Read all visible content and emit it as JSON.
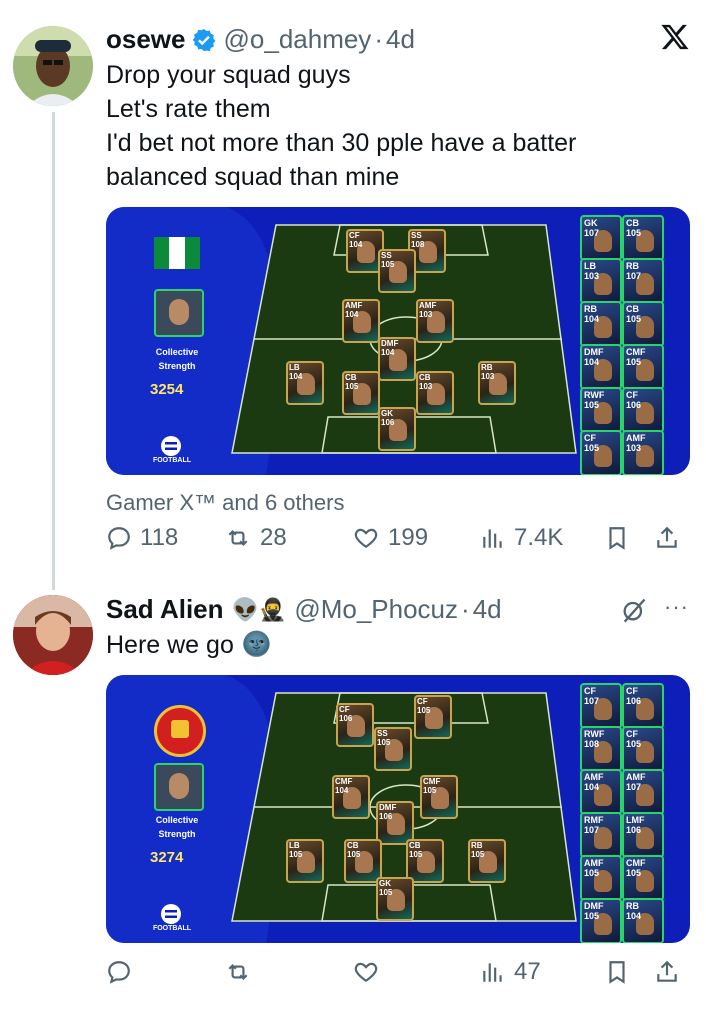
{
  "tweet1": {
    "name": "osewe",
    "handle": "@o_dahmey",
    "dot": "·",
    "time": "4d",
    "text_lines": [
      "Drop your squad guys",
      "Let's rate them",
      "I'd bet not more than 30 pple have a batter",
      "balanced squad than mine"
    ],
    "media": {
      "strength_label_1": "Collective",
      "strength_label_2": "Strength",
      "strength_value": "3254",
      "brand": "FOOTBALL",
      "cards": [
        {
          "pos": "CF",
          "rating": "104"
        },
        {
          "pos": "SS",
          "rating": "108"
        },
        {
          "pos": "SS",
          "rating": "105"
        },
        {
          "pos": "AMF",
          "rating": "104"
        },
        {
          "pos": "AMF",
          "rating": "103"
        },
        {
          "pos": "DMF",
          "rating": "104"
        },
        {
          "pos": "LB",
          "rating": "104"
        },
        {
          "pos": "CB",
          "rating": "105"
        },
        {
          "pos": "CB",
          "rating": "103"
        },
        {
          "pos": "RB",
          "rating": "103"
        },
        {
          "pos": "GK",
          "rating": "106"
        }
      ],
      "subs": [
        {
          "pos": "GK",
          "rating": "107"
        },
        {
          "pos": "CB",
          "rating": "105"
        },
        {
          "pos": "LB",
          "rating": "103"
        },
        {
          "pos": "RB",
          "rating": "107"
        },
        {
          "pos": "RB",
          "rating": "104"
        },
        {
          "pos": "CB",
          "rating": "105"
        },
        {
          "pos": "DMF",
          "rating": "104"
        },
        {
          "pos": "CMF",
          "rating": "105"
        },
        {
          "pos": "RWF",
          "rating": "105"
        },
        {
          "pos": "CF",
          "rating": "106"
        },
        {
          "pos": "CF",
          "rating": "105"
        },
        {
          "pos": "AMF",
          "rating": "103"
        }
      ]
    },
    "liked_by": "Gamer X™ and 6 others",
    "replies": "118",
    "reposts": "28",
    "likes": "199",
    "views": "7.4K"
  },
  "tweet2": {
    "name": "Sad Alien",
    "name_emoji": "👽🥷",
    "handle": "@Mo_Phocuz",
    "dot": "·",
    "time": "4d",
    "text": "Here we go",
    "text_emoji": "🌚",
    "media": {
      "strength_label_1": "Collective",
      "strength_label_2": "Strength",
      "strength_value": "3274",
      "brand": "FOOTBALL",
      "cards": [
        {
          "pos": "CF",
          "rating": "106"
        },
        {
          "pos": "CF",
          "rating": "105"
        },
        {
          "pos": "SS",
          "rating": "105"
        },
        {
          "pos": "CMF",
          "rating": "104"
        },
        {
          "pos": "CMF",
          "rating": "105"
        },
        {
          "pos": "DMF",
          "rating": "106"
        },
        {
          "pos": "LB",
          "rating": "105"
        },
        {
          "pos": "CB",
          "rating": "105"
        },
        {
          "pos": "CB",
          "rating": "105"
        },
        {
          "pos": "RB",
          "rating": "105"
        },
        {
          "pos": "GK",
          "rating": "105"
        }
      ],
      "subs": [
        {
          "pos": "CF",
          "rating": "107"
        },
        {
          "pos": "CF",
          "rating": "106"
        },
        {
          "pos": "RWF",
          "rating": "108"
        },
        {
          "pos": "CF",
          "rating": "105"
        },
        {
          "pos": "AMF",
          "rating": "104"
        },
        {
          "pos": "AMF",
          "rating": "107"
        },
        {
          "pos": "RMF",
          "rating": "107"
        },
        {
          "pos": "LMF",
          "rating": "106"
        },
        {
          "pos": "AMF",
          "rating": "105"
        },
        {
          "pos": "CMF",
          "rating": "105"
        },
        {
          "pos": "DMF",
          "rating": "105"
        },
        {
          "pos": "RB",
          "rating": "104"
        }
      ]
    },
    "views": "47"
  }
}
